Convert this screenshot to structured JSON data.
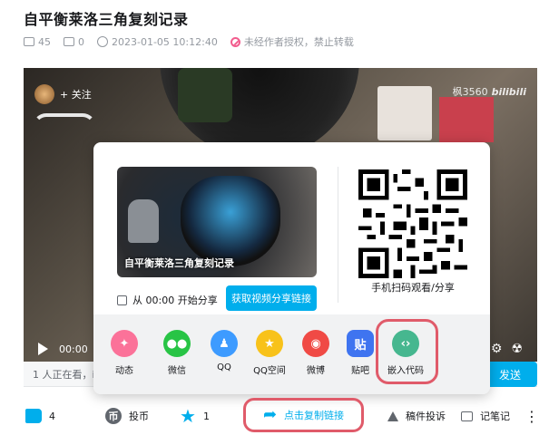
{
  "video": {
    "title": "自平衡莱洛三角复刻记录",
    "views": "45",
    "danmaku": "0",
    "datetime": "2023-01-05 10:12:40",
    "copyright_notice": "未经作者授权，禁止转载"
  },
  "player": {
    "follow_label": "+ 关注",
    "watermark_user": "枫3560",
    "watermark_brand": "bilibili",
    "time": "00:00",
    "online_text": "1 人正在看，i",
    "send_label": "发送"
  },
  "share_popup": {
    "thumb_caption": "自平衡莱洛三角复刻记录",
    "start_share_label": "从 00:00 开始分享",
    "get_link_label": "获取视频分享链接",
    "qr_label": "手机扫码观看/分享",
    "targets": [
      {
        "label": "动态",
        "color": "#fb7299",
        "glyph": "✦"
      },
      {
        "label": "微信",
        "color": "#28c445",
        "glyph": "●●"
      },
      {
        "label": "QQ",
        "color": "#3d9bff",
        "glyph": "♟"
      },
      {
        "label": "QQ空间",
        "color": "#f8c21a",
        "glyph": "★"
      },
      {
        "label": "微博",
        "color": "#f04a45",
        "glyph": "◉"
      },
      {
        "label": "贴吧",
        "color": "#3f74f0",
        "glyph": "贴"
      },
      {
        "label": "嵌入代码",
        "color": "#46b78f",
        "glyph": "‹›"
      }
    ]
  },
  "actions": {
    "like_count": "4",
    "coin_label": "投币",
    "fav_count": "1",
    "copy_link_label": "点击复制链接",
    "report_label": "稿件投诉",
    "note_label": "记笔记",
    "more_label": "⋮"
  }
}
